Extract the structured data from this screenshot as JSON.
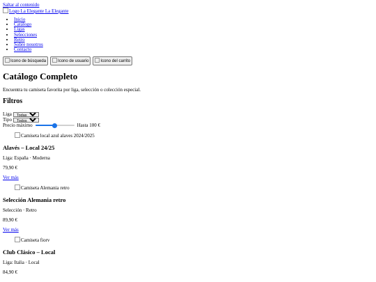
{
  "skip_link": "Saltar al contenido",
  "logo": {
    "alt": "Logo La Elegante",
    "text": "La Elegante"
  },
  "nav": [
    "Inicio",
    "Catálogo",
    "Ligas",
    "Selecciones",
    "Retro",
    "Sobre nosotros",
    "Contacto"
  ],
  "actions": {
    "search": "Icono de búsqueda",
    "user": "Icono de usuario",
    "cart": "Icono del carrito"
  },
  "title": "Catálogo Completo",
  "intro": "Encuentra tu camiseta favorita por liga, selección o colección especial.",
  "filters": {
    "heading": "Filtros",
    "league_label": "Liga",
    "league_value": "Todas",
    "type_label": "Tipo",
    "type_value": "Todos",
    "price_label": "Precio máximo",
    "price_value_fraction": 0.5,
    "price_text": "Hasta 100 €"
  },
  "products": [
    {
      "img_alt": "Camiseta local azul alaves 2024/2025",
      "name": "Alavés – Local 24/25",
      "meta": "Liga: España · Moderna",
      "price": "79,90 €",
      "link": "Ver más"
    },
    {
      "img_alt": "Camiseta Alemania retro",
      "name": "Selección Alemania retro",
      "meta": "Selección · Retro",
      "price": "89,90 €",
      "link": "Ver más"
    },
    {
      "img_alt": "Camiseta fiorv",
      "name": "Club Clásico – Local",
      "meta": "Liga: Italia · Local",
      "price": "84,90 €",
      "link": "Ver más"
    }
  ]
}
